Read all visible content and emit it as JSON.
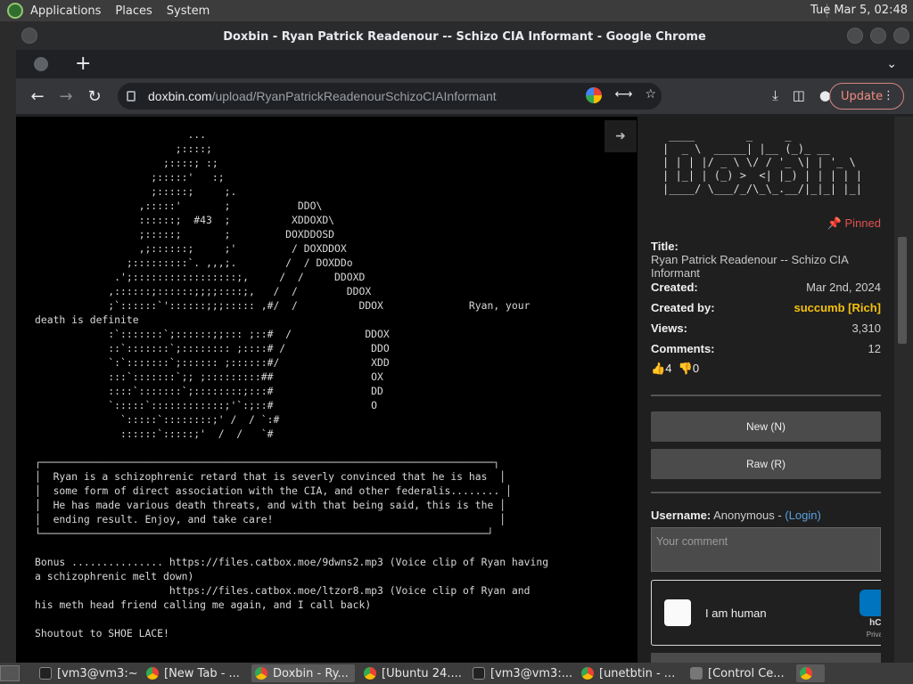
{
  "top_panel": {
    "menus": [
      "Applications",
      "Places",
      "System"
    ],
    "clock": "Tue Mar  5, 02:48"
  },
  "window": {
    "title": "Doxbin - Ryan Patrick Readenour -- Schizo CIA Informant - Google Chrome"
  },
  "toolbar": {
    "url_host": "doxbin.com",
    "url_path": "/upload/RyanPatrickReadenourSchizoCIAInformant",
    "update_label": "Update"
  },
  "paste": {
    "content": "                         ...\n                       ;::::;\n                     ;::::; :;\n                   ;:::::'   :;\n                   ;:::::;     ;.\n                 ,:::::'       ;           DDO\\\n                 ::::::;  #43  ;          XDDOXD\\\n                 ;:::::;       ;         DOXDDOSD\n                 ,;::::::;     ;'         / DOXDDOX\n               ;:::::::::`. ,,,;.        /  / DOXDDo\n             .';:::::::::::::::::;,     /  /     DDOXD\n            ,::::::;::::::;;;;::::;,   /  /        DDOX\n            ;`::::::`'::::::;;;::::: ,#/  /          DDOX              Ryan, your\ndeath is definite\n            :`:::::::`;::::::;;::: ;::#  /            DDOX\n            ::`:::::::`;:::::::: ;::::# /              DDO\n            `:`:::::::`;:::::: ;::::::#/               XDD\n            :::`:::::::`;; ;:::::::::##                OX\n            ::::`:::::::`;::::::::;:::#                DD\n            `:::::`::::::::::::;'`:;::#                O\n              `:::::`::::::::;' /  / `:#\n              ::::::`:::::;'  /  /   `#",
    "box": "┌──────────────────────────────────────────────────────────────────────────┐\n│  Ryan is a schizophrenic retard that is severly convinced that he is has  │\n│  some form of direct association with the CIA, and other federalis........ │\n│  He has made various death threats, and with that being said, this is the │\n│  ending result. Enjoy, and take care!                                     │\n└─────────────────────────────────────────────────────────────────────────┘",
    "footer": "Bonus ............... https://files.catbox.moe/9dwns2.mp3 (Voice clip of Ryan having\na schizophrenic melt down)\n                      https://files.catbox.moe/ltzor8.mp3 (Voice clip of Ryan and\nhis meth head friend calling me again, and I call back)\n\nShoutout to SHOE LACE!"
  },
  "sidebar": {
    "logo": " ____        _     _\n|  _ \\  _____| |__ (_)_ __\n| | | |/ _ \\ \\/ / '_ \\| | '_ \\\n| |_| | (_) >  <| |_) | | | | |\n|____/ \\___/_/\\_\\_.__/|_|_| |_|",
    "pinned": "Pinned",
    "title_label": "Title:",
    "title_value": "Ryan Patrick Readenour -- Schizo CIA Informant",
    "created_label": "Created:",
    "created_value": "Mar 2nd, 2024",
    "created_by_label": "Created by:",
    "created_by_value": "succumb [Rich]",
    "views_label": "Views:",
    "views_value": "3,310",
    "comments_label": "Comments:",
    "comments_value": "12",
    "likes": "4",
    "dislikes": "0",
    "new_button": "New (N)",
    "raw_button": "Raw (R)",
    "username_label": "Username:",
    "username_value": "Anonymous - ",
    "login_link": "(Login)",
    "comment_placeholder": "Your comment",
    "captcha_label": "I am human",
    "captcha_brand": "hCa",
    "captcha_privacy": "Privac"
  },
  "taskbar": {
    "tasks": [
      "[vm3@vm3:~]",
      "[New Tab - ...",
      "Doxbin - Ry...",
      "[Ubuntu 24....",
      "[vm3@vm3:...",
      "[unetbtin - ...",
      "[Control Ce..."
    ]
  },
  "colors": {
    "accent_update": "#f28b82",
    "pinned": "#e05050",
    "rich_user": "#f4c20d",
    "login_link": "#5aa0e0"
  }
}
